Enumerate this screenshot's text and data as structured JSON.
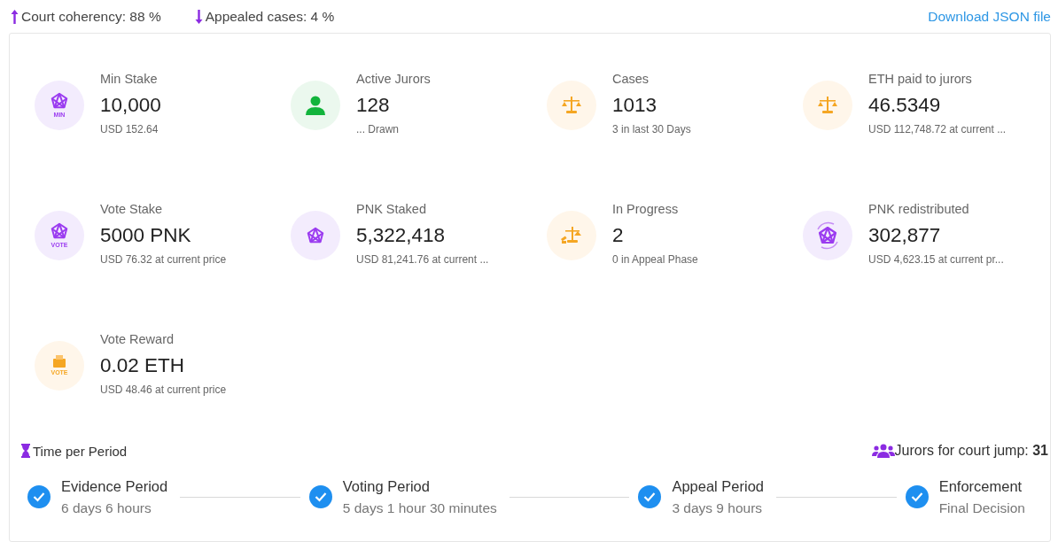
{
  "header": {
    "metrics": [
      {
        "kind": "increase",
        "text": "Court coherency: 88 %"
      },
      {
        "kind": "decrease",
        "text": "Appealed cases: 4 %"
      }
    ],
    "download_link": "Download JSON file"
  },
  "stats": [
    {
      "kind": "pnk",
      "icon_label": "MIN",
      "label": "Min Stake",
      "value": "10,000",
      "sub": "USD 152.64"
    },
    {
      "kind": "juror",
      "label": "Active Jurors",
      "value": "128",
      "sub": "... Drawn"
    },
    {
      "kind": "scales",
      "label": "Cases",
      "value": "1013",
      "sub": "3 in last 30 Days"
    },
    {
      "kind": "scales",
      "label": "ETH paid to jurors",
      "value": "46.5349",
      "sub": "USD 112,748.72 at current ..."
    },
    {
      "kind": "pnk",
      "icon_label": "VOTE",
      "label": "Vote Stake",
      "value": "5000 PNK",
      "sub": "USD 76.32 at current price"
    },
    {
      "kind": "pnk",
      "label": "PNK Staked",
      "value": "5,322,418",
      "sub": "USD 81,241.76 at current ..."
    },
    {
      "kind": "scales-gavel",
      "label": "In Progress",
      "value": "2",
      "sub": "0 in Appeal Phase"
    },
    {
      "kind": "pnk-cycle",
      "label": "PNK redistributed",
      "value": "302,877",
      "sub": "USD 4,623.15 at current pr..."
    },
    {
      "kind": "reward",
      "icon_label": "VOTE",
      "label": "Vote Reward",
      "value": "0.02 ETH",
      "sub": "USD 48.46 at current price"
    }
  ],
  "periods": {
    "title": "Time per Period",
    "jump_text": "Jurors for court jump: **31**",
    "steps": [
      {
        "name": "Evidence Period",
        "duration": "6 days 6 hours",
        "completed": true
      },
      {
        "name": "Voting Period",
        "duration": "5 days 1 hour 30 minutes",
        "completed": true
      },
      {
        "name": "Appeal Period",
        "duration": "3 days 9 hours",
        "completed": true
      },
      {
        "name": "Enforcement",
        "duration": "Final Decision",
        "completed": true
      }
    ]
  }
}
